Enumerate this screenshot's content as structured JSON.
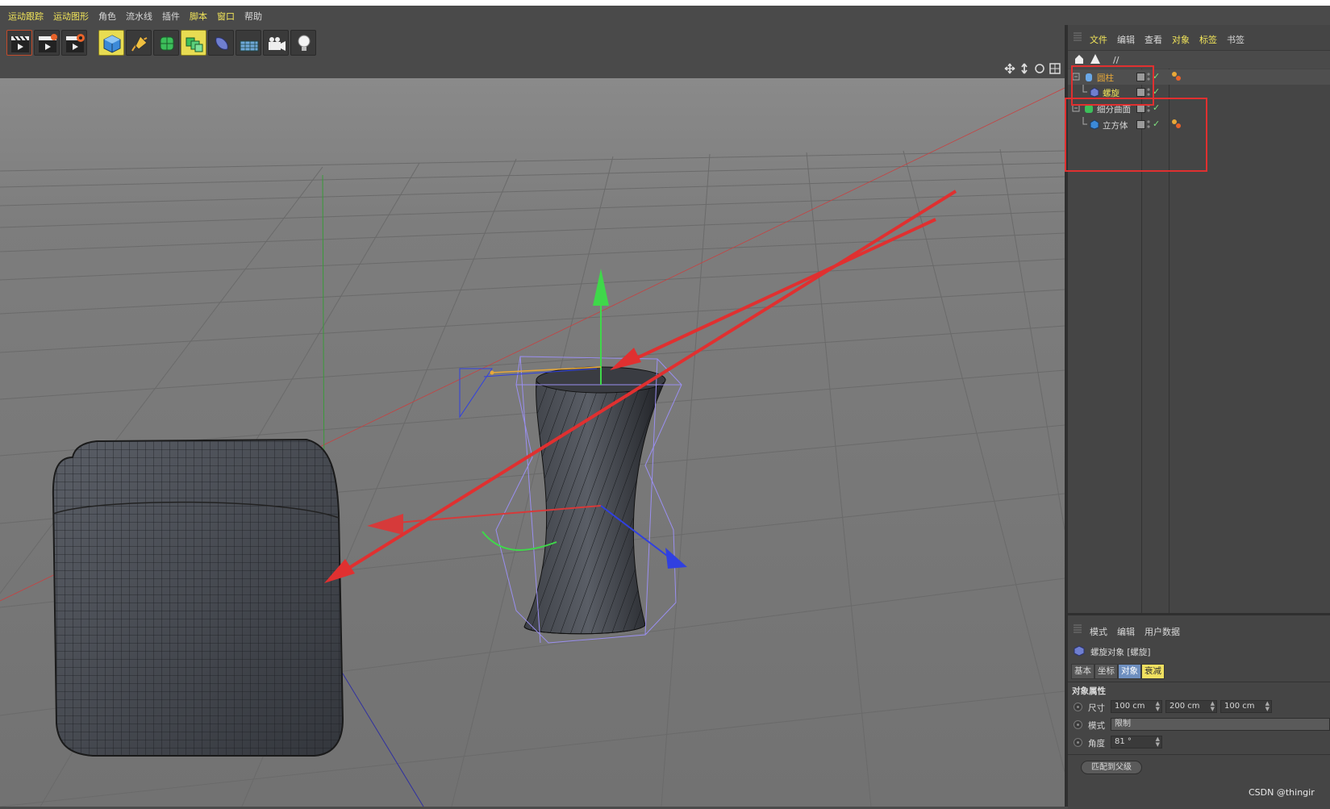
{
  "menubar": {
    "items": [
      "运动跟踪",
      "运动图形",
      "角色",
      "流水线",
      "插件",
      "脚本",
      "窗口",
      "帮助"
    ]
  },
  "toolbar": {
    "buttons": [
      "clapboard-icon",
      "clapboard-arrow-icon",
      "clapboard-gear-icon",
      "cube-icon",
      "pen-icon",
      "subdivision-icon",
      "array-icon",
      "deformer-icon",
      "floor-icon",
      "camera-icon",
      "light-icon"
    ]
  },
  "object_manager": {
    "menu": [
      "文件",
      "编辑",
      "查看",
      "对象",
      "标签",
      "书签"
    ],
    "path": "//",
    "objects": [
      {
        "name": "圆柱",
        "icon": "cylinder-icon",
        "level": 0
      },
      {
        "name": "螺旋",
        "icon": "twist-deformer-icon",
        "level": 1
      },
      {
        "name": "细分曲面",
        "icon": "subdivision-surface-icon",
        "level": 0
      },
      {
        "name": "立方体",
        "icon": "cube-icon",
        "level": 1
      }
    ]
  },
  "attribute_manager": {
    "menu": [
      "模式",
      "编辑",
      "用户数据"
    ],
    "title": "螺旋对象 [螺旋]",
    "tabs": [
      "基本",
      "坐标",
      "对象",
      "衰减"
    ],
    "active_tab": "对象",
    "section": "对象属性",
    "size_label": "尺寸",
    "size_values": [
      "100 cm",
      "200 cm",
      "100 cm"
    ],
    "mode_label": "模式",
    "mode_value": "限制",
    "angle_label": "角度",
    "angle_value": "81 °",
    "fit_button": "匹配到父级"
  },
  "watermark": "CSDN @thingir",
  "colors": {
    "annotation_red": "#e03030",
    "highlight_yellow": "#f2e55a",
    "object_orange": "#e8a838"
  }
}
